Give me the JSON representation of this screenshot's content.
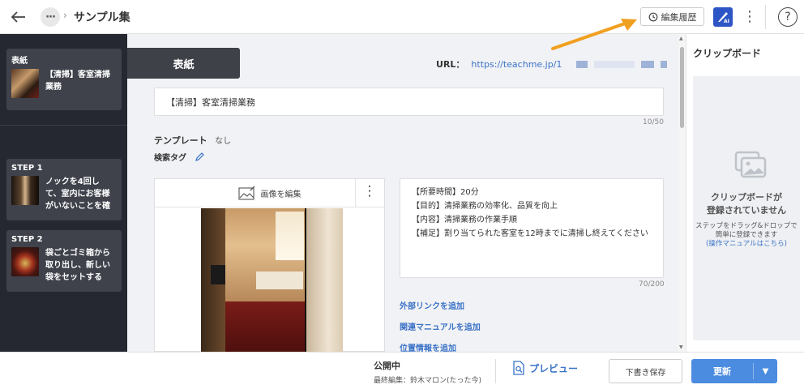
{
  "header": {
    "title": "サンプル集",
    "history_label": "編集履歴",
    "ai_label": "AI",
    "help_label": "?"
  },
  "sidebar": {
    "cover": {
      "label": "表紙",
      "text_line1": "【清掃】客室清掃",
      "text_line2": "業務"
    },
    "steps": [
      {
        "label": "STEP 1",
        "lines": [
          "ノックを4回し",
          "て、室内にお客様",
          "がいないことを確"
        ]
      },
      {
        "label": "STEP 2",
        "lines": [
          "袋ごとゴミ箱から",
          "取り出し、新しい",
          "袋をセットする"
        ]
      }
    ]
  },
  "main": {
    "cover_tab": "表紙",
    "url_label": "URL：",
    "url_value": "https://teachme.jp/1",
    "title_value": "【清掃】客室清掃業務",
    "title_counter": "10/50",
    "template_label": "テンプレート",
    "template_value": "なし",
    "tag_label": "検索タグ",
    "edit_image_label": "画像を編集",
    "description_lines": [
      "【所要時間】20分",
      "【目的】清掃業務の効率化、品質を向上",
      "【内容】清掃業務の作業手順",
      "【補足】割り当てられた客室を12時までに清掃し終えてください"
    ],
    "description_counter": "70/200",
    "links": [
      "外部リンクを追加",
      "関連マニュアルを追加",
      "位置情報を追加"
    ]
  },
  "clipboard": {
    "title": "クリップボード",
    "empty_line1": "クリップボードが",
    "empty_line2": "登録されていません",
    "hint_line1": "ステップをドラッグ&ドロップで",
    "hint_line2": "簡単に登録できます",
    "hint_link": "(操作マニュアルはこちら)"
  },
  "footer": {
    "status_title": "公開中",
    "status_sub": "最終編集：鈴木マロン(たった今)",
    "preview_label": "プレビュー",
    "draft_label": "下書き保存",
    "update_label": "更新"
  },
  "colors": {
    "accent": "#3b73c7",
    "sidebar_bg": "#252830",
    "update_button": "#4b8ce0",
    "annotation_arrow": "#f0a020"
  },
  "icons": [
    "back-arrow-icon",
    "more-horizontal-icon",
    "chevron-right-icon",
    "history-icon",
    "ai-icon",
    "kebab-icon",
    "help-icon",
    "pencil-icon",
    "image-edit-icon",
    "image-placeholder-icon",
    "document-search-icon",
    "caret-down-icon"
  ]
}
